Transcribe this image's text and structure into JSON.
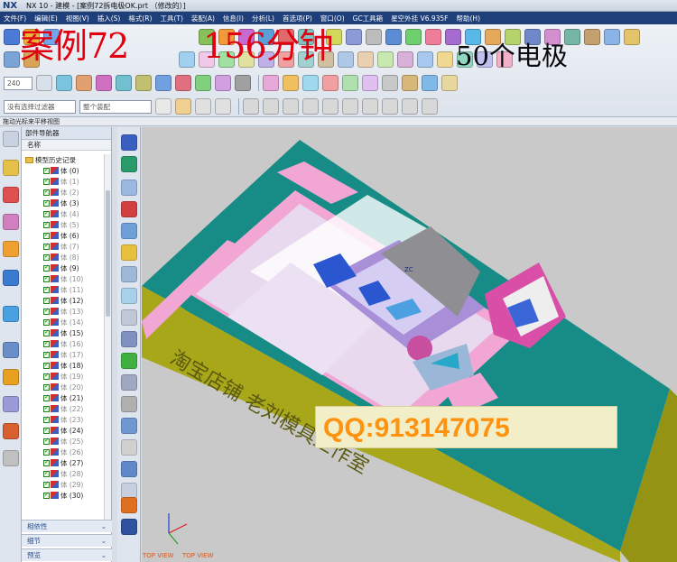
{
  "window": {
    "app_logo": "NX",
    "title": "NX 10 - 建模 - [案例72拆电极OK.prt （修改的）]"
  },
  "menu": [
    "文件(F)",
    "编辑(E)",
    "视图(V)",
    "插入(S)",
    "格式(R)",
    "工具(T)",
    "装配(A)",
    "信息(I)",
    "分析(L)",
    "首选项(P)",
    "窗口(O)",
    "GC工具箱",
    "星空外挂 V6.935F",
    "帮助(H)"
  ],
  "overlay": {
    "case_text": "案例72",
    "minutes_text": "156分钟",
    "electrodes_text": "50个电极",
    "qq_text": "QQ:913147075",
    "shop_text": "淘宝店铺  老刘模具工作室"
  },
  "toolbar": {
    "zoom_value": "240",
    "filter_placeholder": "没有选择过滤器",
    "assembly_placeholder": "整个装配"
  },
  "status_hint": "拖动光标来平移视图",
  "navigator": {
    "title": "部件导航器",
    "column_name": "名称",
    "root": "模型历史记录",
    "bodies": [
      "体 (0)",
      "体 (1)",
      "体 (2)",
      "体 (3)",
      "体 (4)",
      "体 (5)",
      "体 (6)",
      "体 (7)",
      "体 (8)",
      "体 (9)",
      "体 (10)",
      "体 (11)",
      "体 (12)",
      "体 (13)",
      "体 (14)",
      "体 (15)",
      "体 (16)",
      "体 (17)",
      "体 (18)",
      "体 (19)",
      "体 (20)",
      "体 (21)",
      "体 (22)",
      "体 (23)",
      "体 (24)",
      "体 (25)",
      "体 (26)",
      "体 (27)",
      "体 (28)",
      "体 (29)",
      "体 (30)"
    ],
    "sections": [
      "相依性",
      "细节",
      "预览"
    ]
  },
  "viewport": {
    "view_label_1": "TOP VIEW",
    "view_label_2": "TOP VIEW",
    "axis_label": "ZC"
  },
  "colors": {
    "menubar": "#1e3f7a",
    "base_top": "#178c86",
    "base_side": "#a8a71a",
    "part_pink": "#f1a6d4",
    "overlay_red": "#e00010",
    "qq_orange": "#ff9310"
  }
}
